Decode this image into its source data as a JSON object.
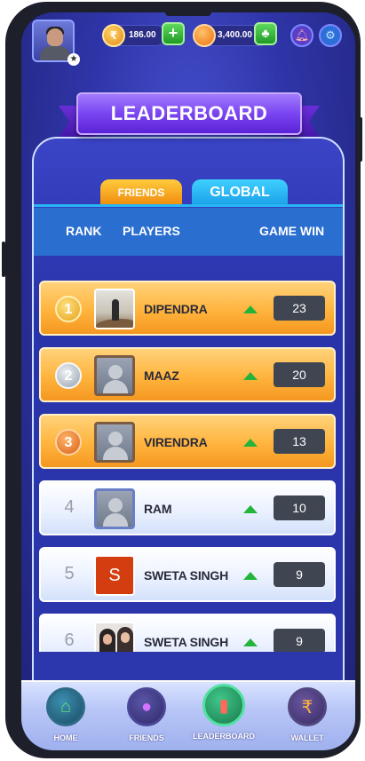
{
  "topbar": {
    "coins": "186.00",
    "gems": "3,400.00",
    "rupee_symbol": "₹",
    "add_label": "+",
    "icons": [
      "profile-avatar",
      "star-icon",
      "rupee-coin-icon",
      "add-icon",
      "gem-coin-icon",
      "add-gem-icon",
      "bell-icon",
      "settings-icon"
    ]
  },
  "banner": {
    "title": "LEADERBOARD"
  },
  "tabs": [
    {
      "label": "FRIENDS",
      "active": false
    },
    {
      "label": "GLOBAL",
      "active": true
    }
  ],
  "columns": {
    "rank": "RANK",
    "players": "PLAYERS",
    "game_win": "GAME WIN"
  },
  "rows": [
    {
      "rank": "1",
      "name": "DIPENDRA",
      "wins": "23",
      "style": "gold"
    },
    {
      "rank": "2",
      "name": "MAAZ",
      "wins": "20",
      "style": "gold"
    },
    {
      "rank": "3",
      "name": "VIRENDRA",
      "wins": "13",
      "style": "gold"
    },
    {
      "rank": "4",
      "name": "RAM",
      "wins": "10",
      "style": "white"
    },
    {
      "rank": "5",
      "name": "SWETA SINGH",
      "wins": "9",
      "style": "white",
      "avatar_letter": "S"
    },
    {
      "rank": "6",
      "name": "SWETA SINGH",
      "wins": "9",
      "style": "white"
    }
  ],
  "nav": [
    {
      "label": "HOME"
    },
    {
      "label": "FRIENDS"
    },
    {
      "label": "LEADERBOARD"
    },
    {
      "label": "WALLET"
    }
  ],
  "colors": {
    "accent_gold": "#ffb43d",
    "tab_blue": "#1a9fe8",
    "up_green": "#23b53a",
    "bg_blue": "#2f35a8"
  }
}
